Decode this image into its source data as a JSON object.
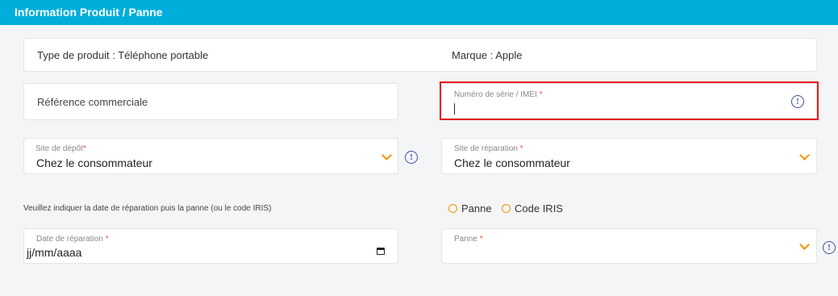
{
  "section": {
    "title": "Information Produit / Panne"
  },
  "product_info": {
    "type_label": "Type de produit : Téléphone portable",
    "brand_label": "Marque : Apple"
  },
  "fields": {
    "reference": {
      "placeholder": "Référence commerciale"
    },
    "serial": {
      "label": "Numéro de série / IMEI",
      "required_mark": "*",
      "value": ""
    },
    "deposit_site": {
      "label": "Site de dépôt",
      "required_mark": "*",
      "value": "Chez le consommateur"
    },
    "repair_site": {
      "label": "Site de réparation",
      "required_mark": "*",
      "value": "Chez le consommateur"
    },
    "repair_date": {
      "label": "Date de réparation",
      "required_mark": "*",
      "value": "jj/mm/aaaa"
    },
    "failure": {
      "label": "Panne",
      "required_mark": "*",
      "value": ""
    }
  },
  "note": "Veuillez indiquer la date de réparation puis la panne (ou le code IRIS)",
  "radio_options": [
    {
      "label": "Panne"
    },
    {
      "label": "Code IRIS"
    }
  ],
  "icons": {
    "info": "info-icon",
    "chevron": "chevron-down-icon",
    "calendar": "calendar-icon"
  },
  "colors": {
    "header": "#00aedb",
    "accent": "#f39200",
    "required": "#e5533b",
    "highlight": "#e51b1b",
    "info_icon": "#3f51a3"
  }
}
